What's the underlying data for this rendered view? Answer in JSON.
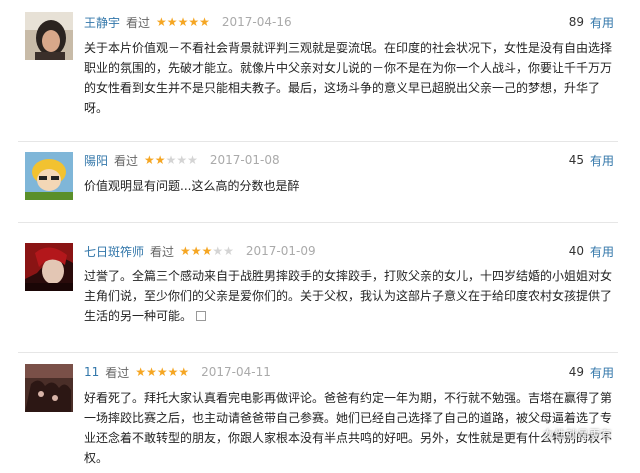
{
  "reviews": [
    {
      "user": "王静宇",
      "watched": "看过",
      "rating": 5,
      "date": "2017-04-16",
      "votes": "89",
      "useful_label": "有用",
      "content": "关于本片价值观－不看社会背景就评判三观就是耍流氓。在印度的社会状况下，女性是没有自由选择职业的氛围的，先破才能立。就像片中父亲对女儿说的－你不是在为你一个人战斗，你要让千千万万的女性看到女生并不是只能相夫教子。最后，这场斗争的意义早已超脱出父亲一己的梦想，升华了呀。"
    },
    {
      "user": "陽阳",
      "watched": "看过",
      "rating": 2,
      "date": "2017-01-08",
      "votes": "45",
      "useful_label": "有用",
      "content": "价值观明显有问题...这么高的分数也是醉"
    },
    {
      "user": "七日斑筰师",
      "watched": "看过",
      "rating": 3,
      "date": "2017-01-09",
      "votes": "40",
      "useful_label": "有用",
      "content": "过誉了。全篇三个感动来自于战胜男摔跤手的女摔跤手，打败父亲的女儿，十四岁结婚的小姐姐对女主角们说，至少你们的父亲是爱你们的。关于父权，我认为这部片子意义在于给印度农村女孩提供了生活的另一种可能。"
    },
    {
      "user": "11",
      "watched": "看过",
      "rating": 5,
      "date": "2017-04-11",
      "votes": "49",
      "useful_label": "有用",
      "content": "好看死了。拜托大家认真看完电影再做评论。爸爸有约定一年为期，不行就不勉强。吉塔在赢得了第一场摔跤比赛之后，也主动请爸爸带自己参赛。她们已经自己选择了自己的道路，被父母逼着选了专业还念着不敢转型的朋友，你跟人家根本没有半点共鸣的好吧。另外，女性就是更有什么特别的权不权。"
    }
  ],
  "watermark": "女性就是更有",
  "colors": {
    "link": "#3377aa",
    "star_on": "#f5a623",
    "star_off": "#d4d4d4",
    "date": "#aaaaaa"
  }
}
